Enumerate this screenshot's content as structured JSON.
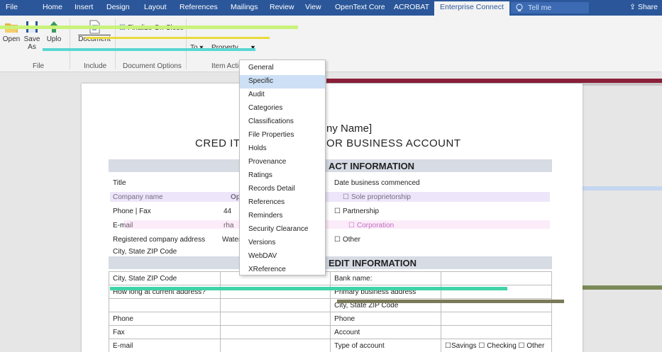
{
  "tabs": [
    "File",
    "Home",
    "Insert",
    "Design",
    "Layout",
    "References",
    "Mailings",
    "Review",
    "View",
    "OpenText Core",
    "ACROBAT",
    "Enterprise Connect"
  ],
  "active_tab": "Enterprise Connect",
  "tell_me": "Tell me",
  "share": "Share",
  "ribbon": {
    "open": "Open",
    "save_as_1": "Save",
    "save_as_2": "As",
    "upload": "Uplo",
    "document": "Document",
    "finalize": "Finalize On Close",
    "to": "To",
    "property": "Property",
    "groups": {
      "file": "File",
      "include": "Include",
      "document_options": "Document Options",
      "item_actions": "Item Actio"
    }
  },
  "menu": {
    "items": [
      "General",
      "Specific",
      "Audit",
      "Categories",
      "Classifications",
      "File Properties",
      "Holds",
      "Provenance",
      "Ratings",
      "Records Detail",
      "References",
      "Reminders",
      "Security Clearance",
      "Versions",
      "WebDAV",
      "XReference"
    ],
    "highlighted": "Specific"
  },
  "doc": {
    "company": "ny Name]",
    "title": "CRED   IT    APPLICATION FOR BUSINESS ACCOUNT",
    "contact_header": "ACT INFORMATION",
    "credit_header": "EDIT INFORMATION",
    "left_fields": [
      "Title",
      "Company name",
      "Phone | Fax",
      "E-mail",
      "Registered company address",
      "City, State ZIP Code"
    ],
    "left_values": [
      "Open",
      "44",
      "rha",
      "Water"
    ],
    "date_commenced": "Date business commenced",
    "options": [
      "Sole proprietorship",
      "Partnership",
      "Corporation",
      "Other"
    ],
    "table": {
      "rows": [
        [
          "City, State ZIP Code",
          "",
          "Bank name:",
          ""
        ],
        [
          "How long at current address?",
          "",
          "Primary business address",
          ""
        ],
        [
          "",
          "",
          "City, State ZIP Code",
          ""
        ],
        [
          "Phone",
          "",
          "Phone",
          ""
        ],
        [
          "Fax",
          "",
          "Account",
          ""
        ],
        [
          "E-mail",
          "",
          "Type of account",
          "☐Savings ☐ Checking ☐ Other"
        ]
      ]
    }
  }
}
